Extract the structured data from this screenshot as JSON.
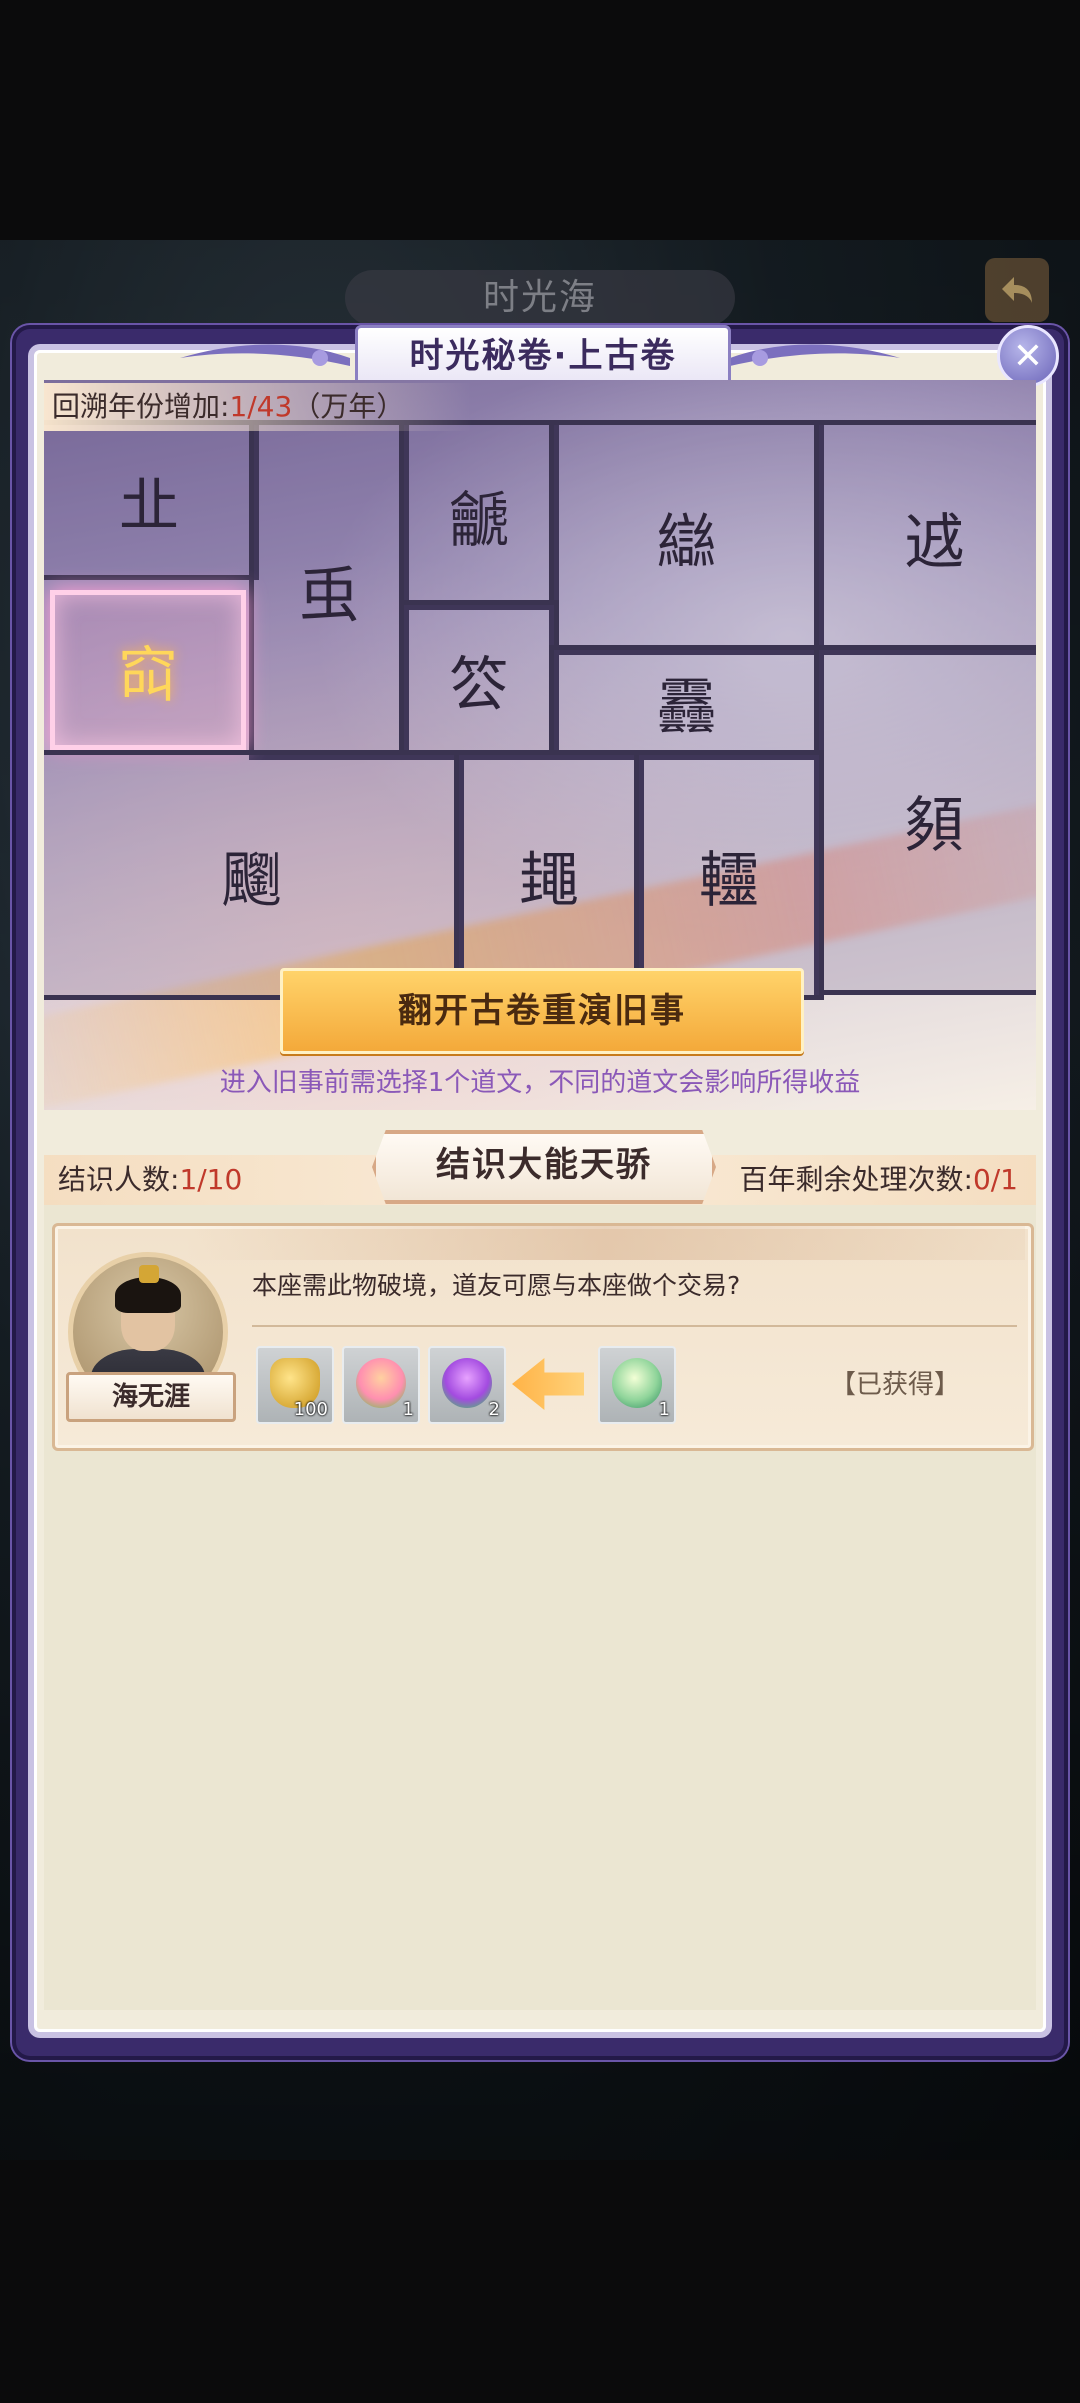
{
  "background": {
    "title": "时光海"
  },
  "dialog": {
    "header_title": "时光秘卷·上古卷",
    "close_icon": "close-icon"
  },
  "year_progress": {
    "label": "回溯年份增加:",
    "value": "1/43",
    "unit": "（万年）"
  },
  "scroll": {
    "tiles": [
      {
        "glyph": "㐀",
        "active": false
      },
      {
        "glyph": "䖝",
        "active": false
      },
      {
        "glyph": "䶵",
        "active": false
      },
      {
        "glyph": "䜌",
        "active": false
      },
      {
        "glyph": "䢕",
        "active": false
      },
      {
        "glyph": "䆗",
        "active": true
      },
      {
        "glyph": "䇗",
        "active": false
      },
      {
        "glyph": "䨺",
        "active": false
      },
      {
        "glyph": "䫂",
        "active": false
      },
      {
        "glyph": "䬟",
        "active": false
      },
      {
        "glyph": "䵷",
        "active": false
      },
      {
        "glyph": "䡿",
        "active": false
      },
      {
        "glyph": "䨻",
        "active": false
      }
    ],
    "open_button": "翻开古卷重演旧事",
    "hint": "进入旧事前需选择1个道文，不同的道文会影响所得收益"
  },
  "acquaintance": {
    "section_title": "结识大能天骄",
    "count_label": "结识人数:",
    "count_value": "1/10",
    "remaining_label": "百年剩余处理次数:",
    "remaining_value": "0/1",
    "card": {
      "name": "海无涯",
      "dialogue": "本座需此物破境，道友可愿与本座做个交易?",
      "give_items": [
        {
          "icon": "gold-ingot-icon",
          "qty": "100"
        },
        {
          "icon": "flower-icon",
          "qty": "1"
        },
        {
          "icon": "lotus-icon",
          "qty": "2"
        }
      ],
      "receive_items": [
        {
          "icon": "jade-orb-icon",
          "qty": "1"
        }
      ],
      "status": "【已获得】"
    }
  }
}
